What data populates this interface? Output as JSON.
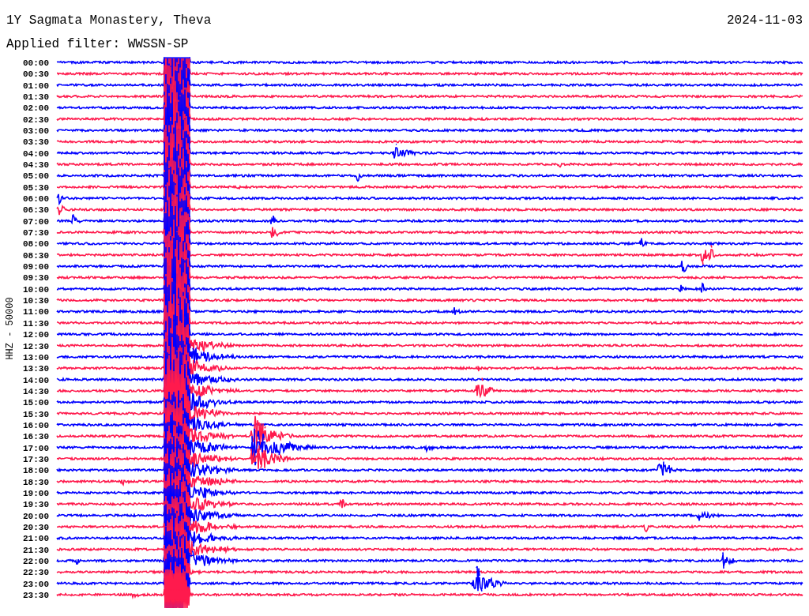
{
  "title": "1Y Sagmata Monastery, Theva",
  "date": "2024-11-03",
  "filter": "Applied filter: WWSSN-SP",
  "channel_label": "HHZ - 50000",
  "rows": [
    {
      "time": "00:00",
      "color": "#0000ff"
    },
    {
      "time": "00:30",
      "color": "#ff1a4d"
    },
    {
      "time": "01:00",
      "color": "#0000ff"
    },
    {
      "time": "01:30",
      "color": "#ff1a4d"
    },
    {
      "time": "02:00",
      "color": "#0000ff"
    },
    {
      "time": "02:30",
      "color": "#ff1a4d"
    },
    {
      "time": "03:00",
      "color": "#0000ff"
    },
    {
      "time": "03:30",
      "color": "#ff1a4d"
    },
    {
      "time": "04:00",
      "color": "#0000ff"
    },
    {
      "time": "04:30",
      "color": "#ff1a4d"
    },
    {
      "time": "05:00",
      "color": "#0000ff"
    },
    {
      "time": "05:30",
      "color": "#ff1a4d"
    },
    {
      "time": "06:00",
      "color": "#0000ff"
    },
    {
      "time": "06:30",
      "color": "#ff1a4d"
    },
    {
      "time": "07:00",
      "color": "#0000ff"
    },
    {
      "time": "07:30",
      "color": "#ff1a4d"
    },
    {
      "time": "08:00",
      "color": "#0000ff"
    },
    {
      "time": "08:30",
      "color": "#ff1a4d"
    },
    {
      "time": "09:00",
      "color": "#0000ff"
    },
    {
      "time": "09:30",
      "color": "#ff1a4d"
    },
    {
      "time": "10:00",
      "color": "#0000ff"
    },
    {
      "time": "10:30",
      "color": "#ff1a4d"
    },
    {
      "time": "11:00",
      "color": "#0000ff"
    },
    {
      "time": "11:30",
      "color": "#ff1a4d"
    },
    {
      "time": "12:00",
      "color": "#0000ff"
    },
    {
      "time": "12:30",
      "color": "#ff1a4d"
    },
    {
      "time": "13:00",
      "color": "#0000ff"
    },
    {
      "time": "13:30",
      "color": "#ff1a4d"
    },
    {
      "time": "14:00",
      "color": "#0000ff"
    },
    {
      "time": "14:30",
      "color": "#ff1a4d"
    },
    {
      "time": "15:00",
      "color": "#0000ff"
    },
    {
      "time": "15:30",
      "color": "#ff1a4d"
    },
    {
      "time": "16:00",
      "color": "#0000ff"
    },
    {
      "time": "16:30",
      "color": "#ff1a4d"
    },
    {
      "time": "17:00",
      "color": "#0000ff"
    },
    {
      "time": "17:30",
      "color": "#ff1a4d"
    },
    {
      "time": "18:00",
      "color": "#0000ff"
    },
    {
      "time": "18:30",
      "color": "#ff1a4d"
    },
    {
      "time": "19:00",
      "color": "#0000ff"
    },
    {
      "time": "19:30",
      "color": "#ff1a4d"
    },
    {
      "time": "20:00",
      "color": "#0000ff"
    },
    {
      "time": "20:30",
      "color": "#ff1a4d"
    },
    {
      "time": "21:00",
      "color": "#0000ff"
    },
    {
      "time": "21:30",
      "color": "#ff1a4d"
    },
    {
      "time": "22:00",
      "color": "#0000ff"
    },
    {
      "time": "22:30",
      "color": "#ff1a4d"
    },
    {
      "time": "23:00",
      "color": "#0000ff"
    },
    {
      "time": "23:30",
      "color": "#ff1a4d"
    }
  ]
}
